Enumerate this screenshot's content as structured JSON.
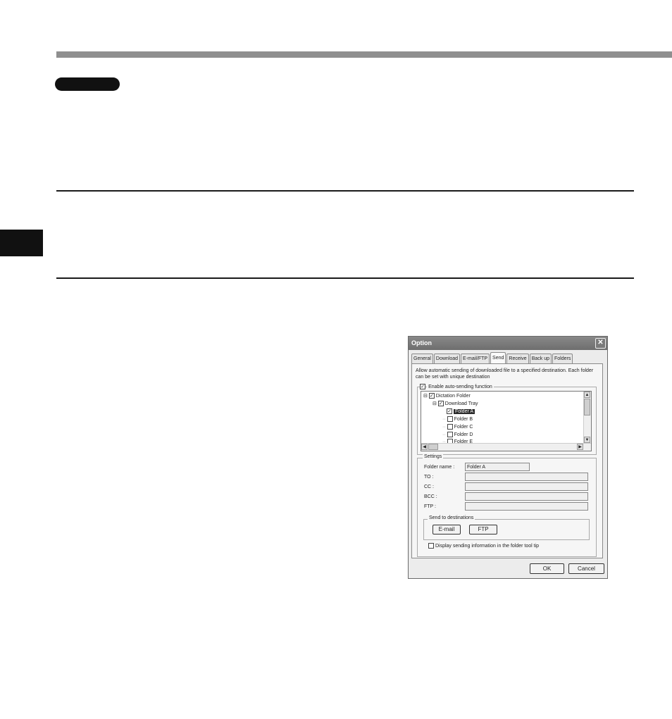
{
  "dialog": {
    "title": "Option",
    "close_glyph": "✕",
    "tabs": [
      "General",
      "Download",
      "E-mail/FTP",
      "Send",
      "Receive",
      "Back up",
      "Folders"
    ],
    "active_tab": "Send",
    "description": "Allow automatic sending of downloaded file to a specified destination. Each folder can be set with unique destination",
    "enable_label": "Enable auto-sending function",
    "tree": [
      {
        "label": "Dictation Folder",
        "checked": true
      },
      {
        "label": "Download Tray",
        "checked": true
      },
      {
        "label": "Folder A",
        "checked": true
      },
      {
        "label": "Folder B",
        "checked": false
      },
      {
        "label": "Folder C",
        "checked": false
      },
      {
        "label": "Folder D",
        "checked": false
      },
      {
        "label": "Folder E",
        "checked": false
      }
    ],
    "settings": {
      "legend": "Settings",
      "folder_name_label": "Folder name :",
      "folder_name_value": "Folder A",
      "to_label": "TO :",
      "cc_label": "CC :",
      "bcc_label": "BCC :",
      "ftp_label": "FTP :",
      "send_to_legend": "Send to destinations",
      "email_button": "E-mail",
      "ftp_button": "FTP",
      "display_info_label": "Display sending information in the folder tool tip"
    },
    "ok_button": "OK",
    "cancel_button": "Cancel"
  },
  "icons": {
    "close": "close-icon",
    "collapse": "minus-box-icon",
    "scroll_up": "triangle-up-icon",
    "scroll_down": "triangle-down-icon",
    "scroll_left": "triangle-left-icon",
    "scroll_right": "triangle-right-icon"
  }
}
